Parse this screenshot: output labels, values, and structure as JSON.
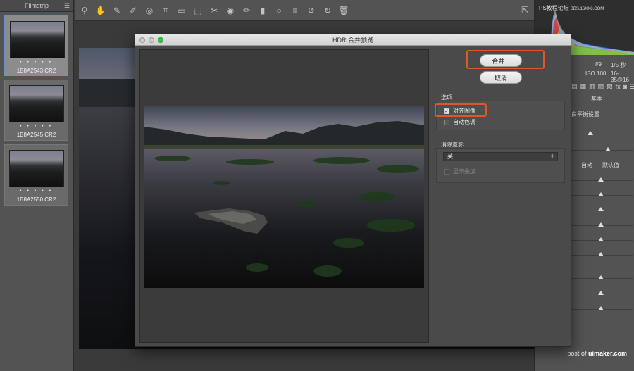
{
  "filmstrip": {
    "title": "Filmstrip",
    "menu_icon": "hamburger-icon",
    "items": [
      {
        "stars": "• • • • •",
        "filename": "1B8A2543.CR2",
        "selected": true
      },
      {
        "stars": "• • • • •",
        "filename": "1B8A2545.CR2",
        "selected": false
      },
      {
        "stars": "• • • • •",
        "filename": "1B8A2550.CR2",
        "selected": false
      }
    ]
  },
  "toolbar": {
    "icons": [
      "zoom-icon",
      "hand-icon",
      "white-balance-icon",
      "color-sampler-icon",
      "target-adjust-icon",
      "crop-icon",
      "straighten-icon",
      "transform-icon",
      "spot-removal-icon",
      "red-eye-icon",
      "adjustment-brush-icon",
      "graduated-filter-icon",
      "radial-filter-icon",
      "presets-icon",
      "rotate-left-icon",
      "rotate-right-icon",
      "trash-icon"
    ],
    "right_icon": "open-preferences-icon"
  },
  "right_panel": {
    "watermark": "PS教程论坛",
    "watermark_url": "BBS.16XX8.COM",
    "exif": {
      "aperture": "f/9",
      "shutter": "1/5 秒",
      "iso": "ISO 100",
      "lens": "16-35@16"
    },
    "tab_title": "基本",
    "section_label": "白平衡设置",
    "auto_label": "自动",
    "default_label": "默认值",
    "footer_prefix": "post of",
    "footer_site": "uimaker.com"
  },
  "dialog": {
    "title": "HDR 合并预览",
    "merge_button": "合并...",
    "cancel_button": "取消",
    "options_title": "选项",
    "align_label": "对齐图像",
    "align_checked": true,
    "auto_tone_label": "自动色调",
    "auto_tone_checked": false,
    "deghost_title": "消除重影",
    "deghost_value": "关",
    "show_overlay_label": "显示叠加",
    "show_overlay_checked": false
  }
}
